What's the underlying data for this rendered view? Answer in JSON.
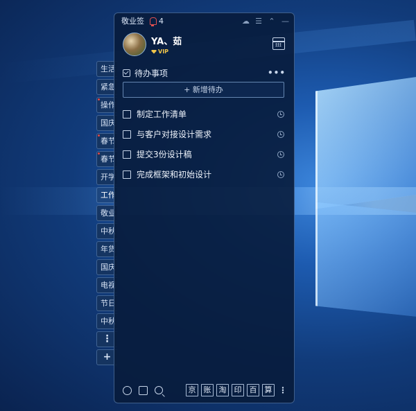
{
  "app": {
    "title": "敬业签",
    "notification_count": "4"
  },
  "user": {
    "name": "YA、茹",
    "badge": "VIP"
  },
  "side_tabs": [
    {
      "label": "生活",
      "dot": false
    },
    {
      "label": "紧急",
      "dot": false
    },
    {
      "label": "操作",
      "dot": true
    },
    {
      "label": "国庆",
      "dot": false
    },
    {
      "label": "春节",
      "dot": true
    },
    {
      "label": "春节",
      "dot": true
    },
    {
      "label": "开学",
      "dot": false
    },
    {
      "label": "工作",
      "dot": false,
      "active": true
    },
    {
      "label": "敬业",
      "dot": false
    },
    {
      "label": "中秋",
      "dot": false
    },
    {
      "label": "年货",
      "dot": false
    },
    {
      "label": "国庆",
      "dot": false
    },
    {
      "label": "电视",
      "dot": false
    },
    {
      "label": "节日",
      "dot": false
    },
    {
      "label": "中秋",
      "dot": false
    }
  ],
  "side_actions": {
    "more": "⋮",
    "add": "+"
  },
  "list": {
    "title": "待办事项",
    "more": "•••",
    "add_button": "+ 新增待办",
    "items": [
      {
        "text": "制定工作清单"
      },
      {
        "text": "与客户对接设计需求"
      },
      {
        "text": "提交3份设计稿"
      },
      {
        "text": "完成框架和初始设计"
      }
    ]
  },
  "toolbar_chars": [
    "京",
    "账",
    "淘",
    "印",
    "百",
    "算"
  ],
  "toolbar_more": "⋮",
  "window_icons": [
    "cloud-icon",
    "menu-icon",
    "collapse-icon",
    "minimize-icon"
  ]
}
